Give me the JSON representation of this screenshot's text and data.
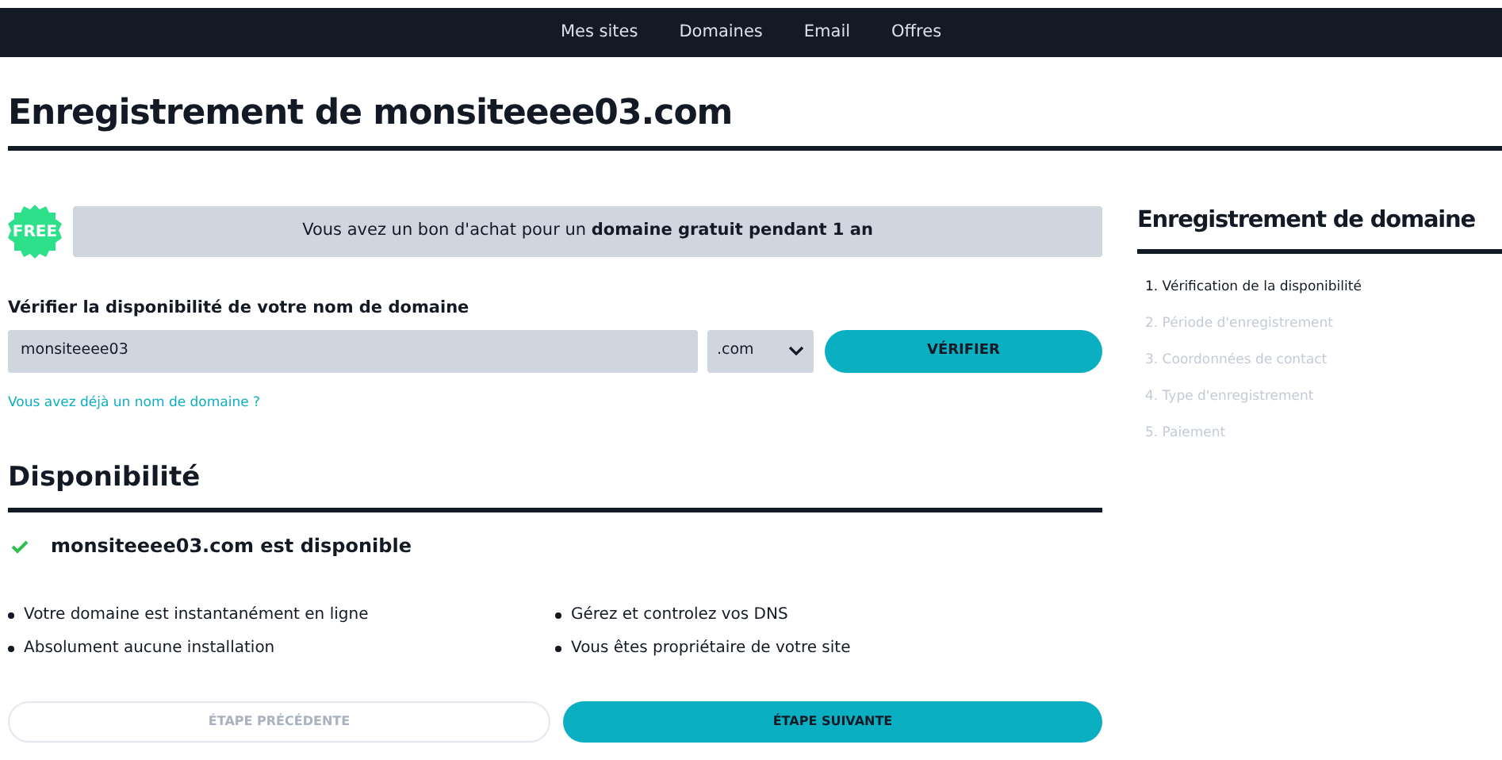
{
  "nav": [
    {
      "label": "Mes sites"
    },
    {
      "label": "Domaines"
    },
    {
      "label": "Email"
    },
    {
      "label": "Offres"
    }
  ],
  "title": "Enregistrement de monsiteeee03.com",
  "voucher": {
    "badge": "FREE",
    "text": "Vous avez un bon d'achat pour un **domaine gratuit pendant 1 an**"
  },
  "search": {
    "label": "Vérifier la disponibilité de votre nom de domaine",
    "value": "monsiteeee03",
    "extension": ".com",
    "button": "VÉRIFIER",
    "link": "Vous avez déjà un nom de domaine ?"
  },
  "availability": {
    "heading": "Disponibilité",
    "result": "monsiteeee03.com est disponible",
    "available": true,
    "features": [
      "Votre domaine est instantanément en ligne",
      "Gérez et controlez vos DNS",
      "Absolument aucune installation",
      "Vous êtes propriétaire de votre site"
    ]
  },
  "buttons": [
    {
      "label": "ÉTAPE PRÉCÉDENTE",
      "disabled": true
    },
    {
      "label": "ÉTAPE SUIVANTE",
      "disabled": false
    }
  ],
  "sidebar": {
    "title": "Enregistrement de domaine",
    "steps": [
      {
        "label": "1. Vérification de la disponibilité",
        "selected": true
      },
      {
        "label": "2. Période d'enregistrement",
        "selected": false
      },
      {
        "label": "3. Coordonnées de contact",
        "selected": false
      },
      {
        "label": "4. Type d'enregistrement",
        "selected": false
      },
      {
        "label": "5. Paiement",
        "selected": false
      }
    ]
  }
}
